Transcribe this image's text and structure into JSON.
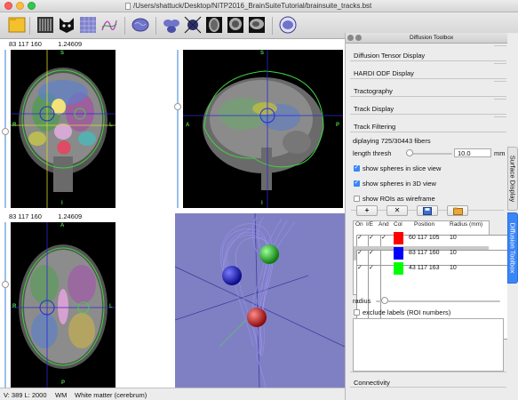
{
  "window": {
    "title": "/Users/shattuck/Desktop/NITP2016_BrainSuiteTutorial/brainsuite_tracks.bst"
  },
  "toolbar": {
    "icons": [
      "folder-icon",
      "histogram-icon",
      "mask-icon",
      "surface-grid-icon",
      "curves-icon",
      "brain-3d-icon",
      "brain-views-icon",
      "crosshair-icon",
      "axial-view-icon",
      "coronal-view-icon",
      "sagittal-view-icon",
      "orthogonal-view-icon"
    ]
  },
  "views": {
    "coronal": {
      "coords": "83 117 160",
      "value": "1.24609",
      "labels": {
        "top": "S",
        "left": "R",
        "right": "L",
        "bottom": "I"
      }
    },
    "sagittal": {
      "labels": {
        "top": "S",
        "left": "A",
        "right": "P",
        "bottom": "I"
      }
    },
    "axial": {
      "coords": "83 117 160",
      "value": "1.24609",
      "labels": {
        "top": "A",
        "left": "R",
        "right": "L",
        "bottom": "P"
      }
    }
  },
  "status": {
    "voxel": "V: 389 L: 2000",
    "label_code": "WM",
    "label_name": "White matter (cerebrum)"
  },
  "toolbox": {
    "title": "Diffusion Toolbox",
    "sections": [
      "Diffusion Tensor Display",
      "HARDI ODF Display",
      "Tractography",
      "Track Display",
      "Track Filtering"
    ],
    "fiber_count": "diplaying 725/30443 fibers",
    "length_thresh_label": "length thresh",
    "length_thresh_value": "10.0",
    "length_unit": "mm",
    "length_slider_fraction": 0.02,
    "checkboxes": [
      {
        "label": "show spheres in slice view",
        "checked": true
      },
      {
        "label": "show spheres in 3D view",
        "checked": true
      },
      {
        "label": "show ROIs as wireframe",
        "checked": false
      }
    ],
    "roi_buttons": [
      {
        "name": "add-roi-button",
        "icon": "plus-icon",
        "glyph": "+"
      },
      {
        "name": "delete-roi-button",
        "icon": "x-icon",
        "glyph": "✕"
      },
      {
        "name": "save-roi-button",
        "icon": "save-icon",
        "glyph": ""
      },
      {
        "name": "open-roi-button",
        "icon": "folder-icon",
        "glyph": ""
      }
    ],
    "table": {
      "headers": [
        "On",
        "I/E",
        "And",
        "Col",
        "Position",
        "Radius (mm)"
      ],
      "rows": [
        {
          "on": true,
          "ie": true,
          "and": true,
          "color": "#ff0000",
          "position": "60 117 105",
          "radius": "10",
          "selected": false
        },
        {
          "on": true,
          "ie": true,
          "and": false,
          "color": "#0000ff",
          "position": "83 117 160",
          "radius": "10",
          "selected": true
        },
        {
          "on": true,
          "ie": true,
          "and": false,
          "color": "#00ff00",
          "position": "43 117 163",
          "radius": "10",
          "selected": false
        }
      ]
    },
    "radius_label": "radius",
    "radius_slider_fraction": 0.05,
    "exclude_label": "exclude labels (ROI numbers)",
    "connectivity": "Connectivity"
  },
  "side_tabs": [
    "Surface Display",
    "Diffusion Toolbox"
  ],
  "colors": {
    "accent": "#3b86f7",
    "fiber": "#8a7fe0",
    "outline": "#3fd43f",
    "cursor": "#2a2ad8"
  }
}
